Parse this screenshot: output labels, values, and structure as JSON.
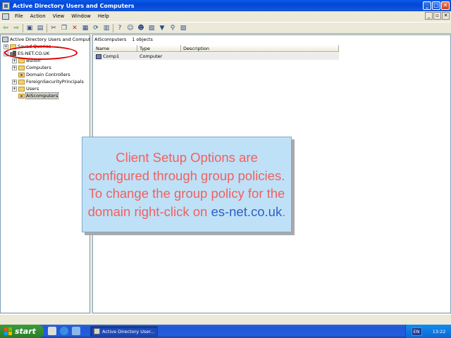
{
  "window": {
    "title": "Active Directory Users and Computers",
    "controls": [
      "_",
      "□",
      "✕"
    ]
  },
  "menu": {
    "items": [
      "File",
      "Action",
      "View",
      "Window",
      "Help"
    ],
    "mdi_controls": [
      "_",
      "▫",
      "✕"
    ]
  },
  "toolbar": {
    "icons": [
      "back-icon",
      "forward-icon",
      "up-icon",
      "show-hide-tree-icon",
      "cut-icon",
      "copy-icon",
      "delete-icon",
      "properties-icon",
      "refresh-icon",
      "export-icon",
      "help-icon",
      "new-user-icon",
      "new-group-icon",
      "new-ou-icon",
      "filter-icon",
      "find-icon",
      "add-to-group-icon"
    ]
  },
  "tree": {
    "root": "Active Directory Users and Computers",
    "saved_queries": "Saved Queries",
    "domain": "ES-NET.CO.UK",
    "children": [
      "Builtin",
      "Computers",
      "Domain Controllers",
      "ForeignSecurityPrincipals",
      "Users",
      "AIScomputers"
    ]
  },
  "details": {
    "path": "AIScomputers",
    "count": "1 objects",
    "columns": [
      "Name",
      "Type",
      "Description"
    ],
    "rows": [
      {
        "name": "Comp1",
        "type": "Computer",
        "description": ""
      }
    ]
  },
  "callout": {
    "text": "Client Setup Options are configured through group policies. To change the group policy for the domain right-click on",
    "link": "es-net.co.uk",
    "tail": "."
  },
  "taskbar": {
    "start": "start",
    "task": "Active Directory User...",
    "language": "EN",
    "clock": "13:22"
  },
  "colors": {
    "annotation_ellipse": "#e00000",
    "callout_bg": "#bfe1f7",
    "callout_text": "#f06060",
    "callout_link": "#2f5ec9"
  }
}
